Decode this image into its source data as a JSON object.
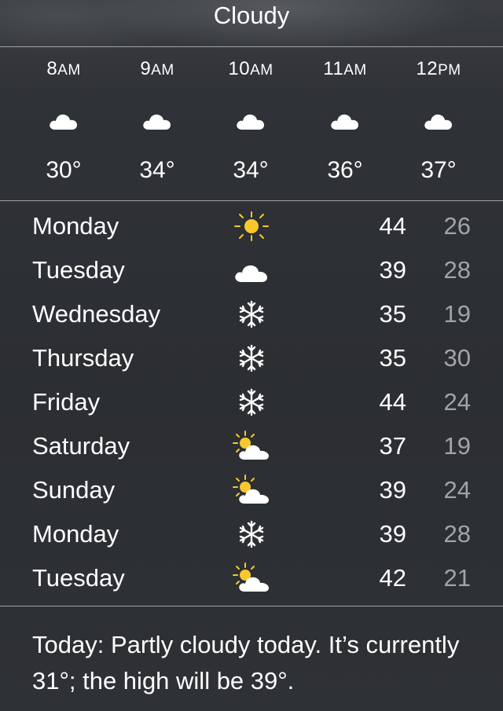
{
  "header": {
    "condition": "Cloudy"
  },
  "hourly": [
    {
      "time": "8",
      "ampm": "AM",
      "icon": "cloud-icon",
      "temp": "30°"
    },
    {
      "time": "9",
      "ampm": "AM",
      "icon": "cloud-icon",
      "temp": "34°"
    },
    {
      "time": "10",
      "ampm": "AM",
      "icon": "cloud-icon",
      "temp": "34°"
    },
    {
      "time": "11",
      "ampm": "AM",
      "icon": "cloud-icon",
      "temp": "36°"
    },
    {
      "time": "12",
      "ampm": "PM",
      "icon": "cloud-icon",
      "temp": "37°"
    }
  ],
  "daily": [
    {
      "day": "Monday",
      "icon": "sun-icon",
      "high": "44",
      "low": "26"
    },
    {
      "day": "Tuesday",
      "icon": "cloud-icon",
      "high": "39",
      "low": "28"
    },
    {
      "day": "Wednesday",
      "icon": "snowflake-icon",
      "high": "35",
      "low": "19"
    },
    {
      "day": "Thursday",
      "icon": "snowflake-icon",
      "high": "35",
      "low": "30"
    },
    {
      "day": "Friday",
      "icon": "snowflake-icon",
      "high": "44",
      "low": "24"
    },
    {
      "day": "Saturday",
      "icon": "partly-cloudy-icon",
      "high": "37",
      "low": "19"
    },
    {
      "day": "Sunday",
      "icon": "partly-cloudy-icon",
      "high": "39",
      "low": "24"
    },
    {
      "day": "Monday",
      "icon": "snowflake-icon",
      "high": "39",
      "low": "28"
    },
    {
      "day": "Tuesday",
      "icon": "partly-cloudy-icon",
      "high": "42",
      "low": "21"
    }
  ],
  "summary": {
    "text": "Today: Partly cloudy today. It’s currently 31°; the high will be 39°."
  },
  "colors": {
    "sun": "#f9c82d",
    "low_temp": "#a1a5aa",
    "text": "#ffffff",
    "background": "#2c2f33"
  }
}
